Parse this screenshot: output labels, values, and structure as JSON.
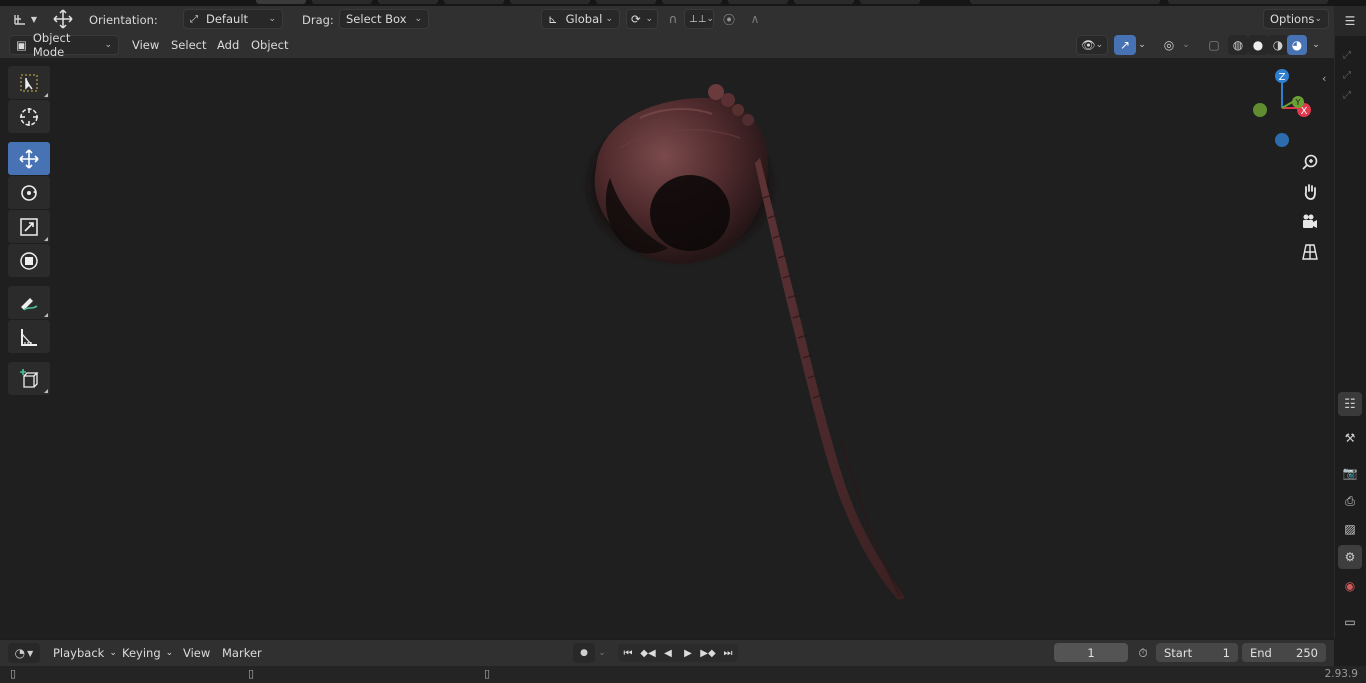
{
  "header": {
    "orientation_label": "Orientation:",
    "orientation_value": "Default",
    "drag_label": "Drag:",
    "drag_value": "Select Box",
    "transform_orientation": "Global",
    "options_label": "Options"
  },
  "viewport_header": {
    "mode": "Object Mode",
    "menus": [
      "View",
      "Select",
      "Add",
      "Object"
    ]
  },
  "tools": [
    {
      "name": "select-box-tool",
      "icon": "select-box-icon",
      "active": false
    },
    {
      "name": "cursor-tool",
      "icon": "cursor-icon",
      "active": false
    },
    {
      "name": "move-tool",
      "icon": "move-icon",
      "active": true
    },
    {
      "name": "rotate-tool",
      "icon": "rotate-icon",
      "active": false
    },
    {
      "name": "scale-tool",
      "icon": "scale-icon",
      "active": false
    },
    {
      "name": "transform-tool",
      "icon": "transform-icon",
      "active": false
    },
    {
      "name": "annotate-tool",
      "icon": "annotate-icon",
      "active": false
    },
    {
      "name": "measure-tool",
      "icon": "measure-icon",
      "active": false
    },
    {
      "name": "add-cube-tool",
      "icon": "add-cube-icon",
      "active": false
    }
  ],
  "gizmo": {
    "z_label": "Z",
    "x_label": "X",
    "y_label": "Y"
  },
  "timeline": {
    "menus": [
      "Playback",
      "Keying",
      "View",
      "Marker"
    ],
    "current_frame": "1",
    "start_label": "Start",
    "start_value": "1",
    "end_label": "End",
    "end_value": "250"
  },
  "status": {
    "version": "2.93.9"
  },
  "colors": {
    "accent": "#4772b3",
    "x_axis": "#e0384d",
    "y_axis": "#6ba134",
    "z_axis": "#2f7fd1",
    "hair": "#5a2f31"
  }
}
